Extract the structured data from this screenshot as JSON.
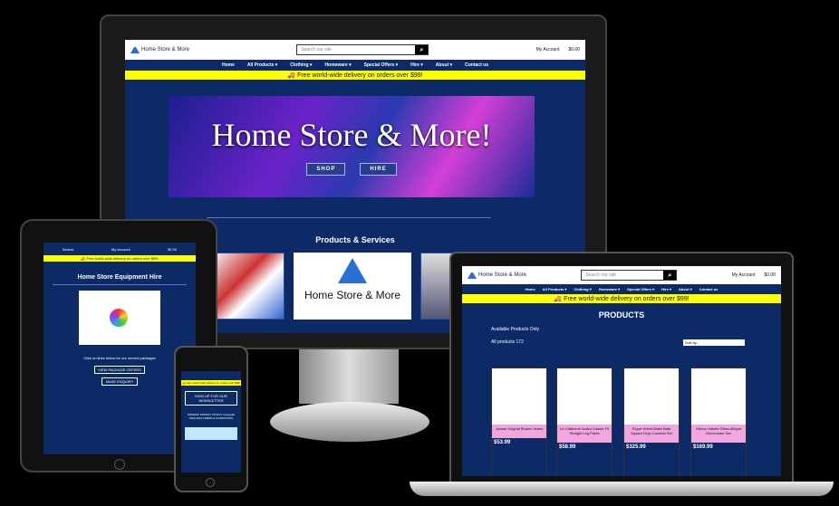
{
  "site": {
    "logo_text": "Home Store & More",
    "search_placeholder": "Search our site",
    "my_account": "My Account",
    "cart_total": "$0.00",
    "promo": "🚚 Free world-wide delivery on orders over $99!",
    "nav": [
      "Home",
      "All Products ▾",
      "Clothing ▾",
      "Homeware ▾",
      "Special Offers ▾",
      "Hire ▾",
      "About ▾",
      "Contact us"
    ]
  },
  "monitor": {
    "hero_title": "Home Store & More!",
    "hero_buttons": [
      "SHOP",
      "HIRE"
    ],
    "products_services": "Products & Services",
    "card_logo_text": "Home Store & More"
  },
  "tablet": {
    "title": "Home Store Equipment Hire",
    "top_labels": [
      "Search",
      "My Account",
      "$0.00"
    ],
    "blurb": "Click on links below for our current packages",
    "btn1": "VIEW PACKAGE OFFERS",
    "btn2": "MAKE ENQUIRY"
  },
  "phone": {
    "signup": "SIGN UP FOR OUR NEWSLETTER",
    "links": "SITEMAP  PRIVACY POLICY  Copyright 2022-2023 TERMS & CONDITIONS"
  },
  "laptop": {
    "heading": "PRODUCTS",
    "available_only": "Available Products Only",
    "count": "All products 172",
    "sort": "Sort by...",
    "products": [
      {
        "name": "Jordan Original Boston Jeans",
        "price": "$53.99"
      },
      {
        "name": "Liz Claiborne Audra Classic Fit Straight Leg Pants",
        "price": "$58.99"
      },
      {
        "name": "Royal Velvet Make Bath Square Drop Coverlet Set",
        "price": "$325.99"
      },
      {
        "name": "Gibson Infinite Glass Allegra Dinnerware Set",
        "price": "$169.99"
      }
    ]
  }
}
